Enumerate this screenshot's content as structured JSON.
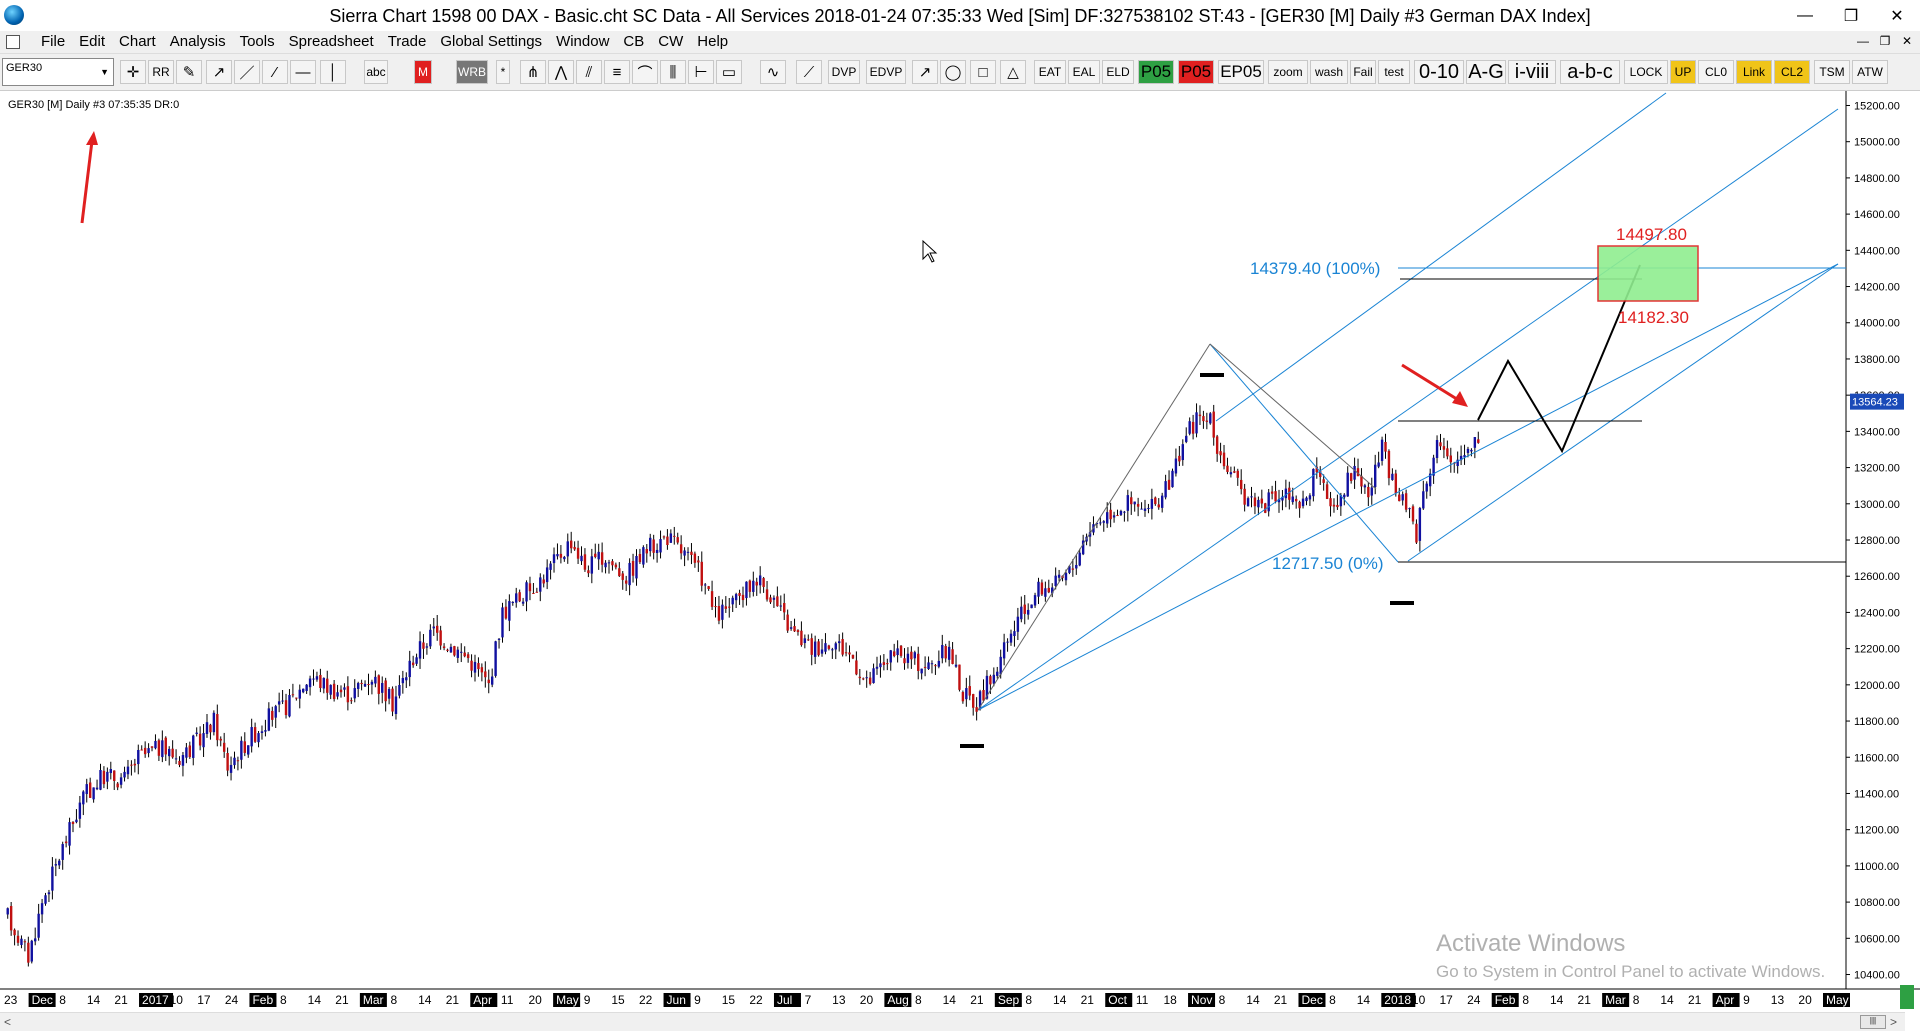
{
  "window": {
    "title": "Sierra Chart 1598 00 DAX - Basic.cht  SC Data - All Services 2018-01-24  07:35:33 Wed [Sim]  DF:327538102  ST:43 - [GER30 [M]  Daily  #3  German DAX Index]",
    "controls": [
      "—",
      "❐",
      "✕"
    ]
  },
  "menu": [
    "File",
    "Edit",
    "Chart",
    "Analysis",
    "Tools",
    "Spreadsheet",
    "Trade",
    "Global Settings",
    "Window",
    "CB",
    "CW",
    "Help"
  ],
  "mdi_controls": [
    "—",
    "❐",
    "✕"
  ],
  "toolbar": {
    "symbol": "GER30",
    "buttons": [
      {
        "label": "RR",
        "icon": "rr-icon"
      },
      {
        "label": "abc",
        "icon": "text-tool-icon"
      },
      {
        "label": "M",
        "icon": "m-button"
      },
      {
        "label": "WRB",
        "icon": "wrb-button"
      },
      {
        "label": "*",
        "icon": "star-button"
      },
      {
        "label": "DVP",
        "icon": "dvp-button"
      },
      {
        "label": "EDVP",
        "icon": "edvp-button"
      },
      {
        "label": "EAT",
        "icon": "eat-button"
      },
      {
        "label": "EAL",
        "icon": "eal-button"
      },
      {
        "label": "ELD",
        "icon": "eld-button"
      },
      {
        "label": "P05",
        "icon": "p05-green-button"
      },
      {
        "label": "P05",
        "icon": "p05-red-button"
      },
      {
        "label": "EP05",
        "icon": "ep05-button"
      },
      {
        "label": "zoom",
        "icon": "zoom-button"
      },
      {
        "label": "wash",
        "icon": "wash-button"
      },
      {
        "label": "Fail",
        "icon": "fail-button"
      },
      {
        "label": "test",
        "icon": "test-button"
      },
      {
        "label": "0-10",
        "icon": "count-0-10-button"
      },
      {
        "label": "A-G",
        "icon": "count-a-g-button"
      },
      {
        "label": "i-viii",
        "icon": "count-i-viii-button"
      },
      {
        "label": "a-b-c",
        "icon": "count-a-b-c-button"
      },
      {
        "label": "LOCK",
        "icon": "lock-button"
      },
      {
        "label": "UP",
        "icon": "up-button"
      },
      {
        "label": "CL0",
        "icon": "cl0-button"
      },
      {
        "label": "Link",
        "icon": "link-button"
      },
      {
        "label": "CL2",
        "icon": "cl2-button"
      },
      {
        "label": "TSM",
        "icon": "tsm-button"
      },
      {
        "label": "ATW",
        "icon": "atw-button"
      }
    ]
  },
  "chart": {
    "header": "GER30 [M]  Daily  #3 07:35:35 DR:0",
    "price_marker": "13564.23",
    "annotations": {
      "fib_100": "14379.40  (100%)",
      "fib_0": "12717.50  (0%)",
      "target_high": "14497.80",
      "target_low": "14182.30"
    },
    "colors": {
      "up_candle": "#1010a0",
      "down_candle": "#c01010",
      "channel": "#1a84d4",
      "target_box": "#90ee90",
      "target_border": "#e02020",
      "red_label": "#e02020"
    }
  },
  "chart_data": {
    "type": "candlestick",
    "title": "GER30 [M] Daily",
    "ylim": [
      10320,
      15280
    ],
    "y_ticks": [
      "15200.00",
      "15000.00",
      "14800.00",
      "14600.00",
      "14400.00",
      "14200.00",
      "14000.00",
      "13800.00",
      "13600.00",
      "13400.00",
      "13200.00",
      "13000.00",
      "12800.00",
      "12600.00",
      "12400.00",
      "12200.00",
      "12000.00",
      "11800.00",
      "11600.00",
      "11400.00",
      "11200.00",
      "11000.00",
      "10800.00",
      "10600.00",
      "10400.00"
    ],
    "x_ticks": [
      {
        "label": "23",
        "box": false
      },
      {
        "label": "Dec",
        "box": true
      },
      {
        "label": "8",
        "box": false
      },
      {
        "label": "14",
        "box": false
      },
      {
        "label": "21",
        "box": false
      },
      {
        "label": "2017",
        "box": true
      },
      {
        "label": "10",
        "box": false
      },
      {
        "label": "17",
        "box": false
      },
      {
        "label": "24",
        "box": false
      },
      {
        "label": "Feb",
        "box": true
      },
      {
        "label": "8",
        "box": false
      },
      {
        "label": "14",
        "box": false
      },
      {
        "label": "21",
        "box": false
      },
      {
        "label": "Mar",
        "box": true
      },
      {
        "label": "8",
        "box": false
      },
      {
        "label": "14",
        "box": false
      },
      {
        "label": "21",
        "box": false
      },
      {
        "label": "Apr",
        "box": true
      },
      {
        "label": "11",
        "box": false
      },
      {
        "label": "20",
        "box": false
      },
      {
        "label": "May",
        "box": true
      },
      {
        "label": "9",
        "box": false
      },
      {
        "label": "15",
        "box": false
      },
      {
        "label": "22",
        "box": false
      },
      {
        "label": "Jun",
        "box": true
      },
      {
        "label": "9",
        "box": false
      },
      {
        "label": "15",
        "box": false
      },
      {
        "label": "22",
        "box": false
      },
      {
        "label": "Jul",
        "box": true
      },
      {
        "label": "7",
        "box": false
      },
      {
        "label": "13",
        "box": false
      },
      {
        "label": "20",
        "box": false
      },
      {
        "label": "Aug",
        "box": true
      },
      {
        "label": "8",
        "box": false
      },
      {
        "label": "14",
        "box": false
      },
      {
        "label": "21",
        "box": false
      },
      {
        "label": "Sep",
        "box": true
      },
      {
        "label": "8",
        "box": false
      },
      {
        "label": "14",
        "box": false
      },
      {
        "label": "21",
        "box": false
      },
      {
        "label": "Oct",
        "box": true
      },
      {
        "label": "11",
        "box": false
      },
      {
        "label": "18",
        "box": false
      },
      {
        "label": "Nov",
        "box": true
      },
      {
        "label": "8",
        "box": false
      },
      {
        "label": "14",
        "box": false
      },
      {
        "label": "21",
        "box": false
      },
      {
        "label": "Dec",
        "box": true
      },
      {
        "label": "8",
        "box": false
      },
      {
        "label": "14",
        "box": false
      },
      {
        "label": "2018",
        "box": true
      },
      {
        "label": "10",
        "box": false
      },
      {
        "label": "17",
        "box": false
      },
      {
        "label": "24",
        "box": false
      },
      {
        "label": "Feb",
        "box": true
      },
      {
        "label": "8",
        "box": false
      },
      {
        "label": "14",
        "box": false
      },
      {
        "label": "21",
        "box": false
      },
      {
        "label": "Mar",
        "box": true
      },
      {
        "label": "8",
        "box": false
      },
      {
        "label": "14",
        "box": false
      },
      {
        "label": "21",
        "box": false
      },
      {
        "label": "Apr",
        "box": true
      },
      {
        "label": "9",
        "box": false
      },
      {
        "label": "13",
        "box": false
      },
      {
        "label": "20",
        "box": false
      },
      {
        "label": "May",
        "box": true
      }
    ],
    "waypoints": [
      [
        0,
        10720
      ],
      [
        6,
        10500
      ],
      [
        10,
        10800
      ],
      [
        16,
        11100
      ],
      [
        22,
        11380
      ],
      [
        28,
        11500
      ],
      [
        34,
        11480
      ],
      [
        38,
        11600
      ],
      [
        44,
        11650
      ],
      [
        50,
        11600
      ],
      [
        56,
        11700
      ],
      [
        60,
        11800
      ],
      [
        64,
        11550
      ],
      [
        70,
        11700
      ],
      [
        76,
        11820
      ],
      [
        82,
        11900
      ],
      [
        88,
        12050
      ],
      [
        94,
        11980
      ],
      [
        100,
        11950
      ],
      [
        106,
        12050
      ],
      [
        112,
        11900
      ],
      [
        118,
        12150
      ],
      [
        124,
        12300
      ],
      [
        128,
        12230
      ],
      [
        134,
        12150
      ],
      [
        140,
        12000
      ],
      [
        144,
        12400
      ],
      [
        150,
        12500
      ],
      [
        156,
        12600
      ],
      [
        160,
        12700
      ],
      [
        164,
        12800
      ],
      [
        168,
        12650
      ],
      [
        174,
        12700
      ],
      [
        180,
        12600
      ],
      [
        186,
        12750
      ],
      [
        192,
        12820
      ],
      [
        198,
        12700
      ],
      [
        202,
        12600
      ],
      [
        206,
        12380
      ],
      [
        212,
        12450
      ],
      [
        218,
        12600
      ],
      [
        222,
        12500
      ],
      [
        228,
        12300
      ],
      [
        234,
        12200
      ],
      [
        240,
        12250
      ],
      [
        246,
        12150
      ],
      [
        250,
        12000
      ],
      [
        256,
        12150
      ],
      [
        262,
        12150
      ],
      [
        268,
        12100
      ],
      [
        274,
        12200
      ],
      [
        278,
        11950
      ],
      [
        282,
        11900
      ],
      [
        288,
        12100
      ],
      [
        294,
        12350
      ],
      [
        300,
        12530
      ],
      [
        306,
        12560
      ],
      [
        310,
        12650
      ],
      [
        314,
        12850
      ],
      [
        320,
        12950
      ],
      [
        326,
        13000
      ],
      [
        332,
        12950
      ],
      [
        338,
        13100
      ],
      [
        342,
        13350
      ],
      [
        346,
        13470
      ],
      [
        350,
        13450
      ],
      [
        352,
        13320
      ],
      [
        356,
        13150
      ],
      [
        360,
        13050
      ],
      [
        366,
        13000
      ],
      [
        372,
        13060
      ],
      [
        376,
        12950
      ],
      [
        380,
        13150
      ],
      [
        386,
        13000
      ],
      [
        392,
        13200
      ],
      [
        396,
        13050
      ],
      [
        400,
        13300
      ],
      [
        404,
        13050
      ],
      [
        408,
        12960
      ],
      [
        410,
        12840
      ],
      [
        412,
        13080
      ],
      [
        416,
        13350
      ],
      [
        420,
        13200
      ],
      [
        424,
        13300
      ],
      [
        428,
        13380
      ]
    ],
    "price_line": 13564.23
  }
}
